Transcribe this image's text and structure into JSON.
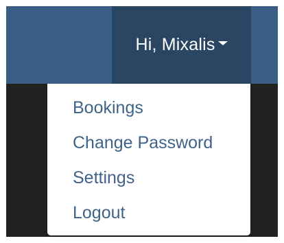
{
  "navbar": {
    "user_greeting": "Hi, Mixalis",
    "caret_icon": "caret-down-icon",
    "colors": {
      "bar": "#3a5f86",
      "active_item": "#2b4662",
      "page_background": "#222222",
      "link": "#3f6389"
    }
  },
  "dropdown": {
    "items": [
      {
        "label": "Bookings"
      },
      {
        "label": "Change Password"
      },
      {
        "label": "Settings"
      },
      {
        "label": "Logout"
      }
    ]
  }
}
